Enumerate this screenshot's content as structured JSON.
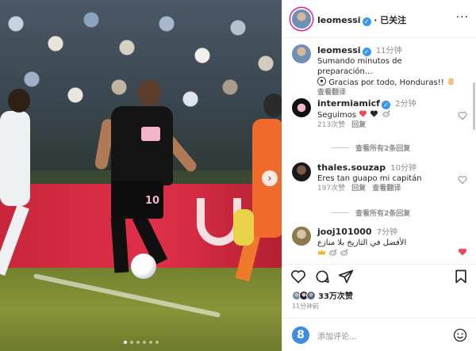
{
  "post": {
    "author": "leomessi",
    "follow_status": "· 已关注",
    "caption_time": "11分钟",
    "caption_line1": "Sumando minutos de preparación...",
    "caption_line2": "Gracias por todo, Honduras!!",
    "see_translation": "查看翻译",
    "jersey_number": "10"
  },
  "comments": [
    {
      "user": "intermiamicf",
      "time": "2分钟",
      "text": "Seguimos",
      "likes": "213次赞",
      "reply": "回复",
      "view_replies": "查看所有2条回复"
    },
    {
      "user": "thales.souzap",
      "time": "10分钟",
      "text": "Eres tan guapo mi capitán",
      "likes": "197次赞",
      "reply": "回复",
      "translate": "查看翻译",
      "view_replies": "查看所有2条回复"
    },
    {
      "user": "jooj101000",
      "time": "7分钟",
      "text": "الأفضل في التاريخ بلا منازع"
    }
  ],
  "actions": {
    "likes_count": "33万次赞",
    "posted_time": "11分钟前"
  },
  "composer": {
    "placeholder": "添加评论...",
    "avatar_letter": "8"
  },
  "colors": {
    "verified": "#3897f0",
    "heart_red": "#ed4956",
    "muted": "#8e8e8e"
  }
}
